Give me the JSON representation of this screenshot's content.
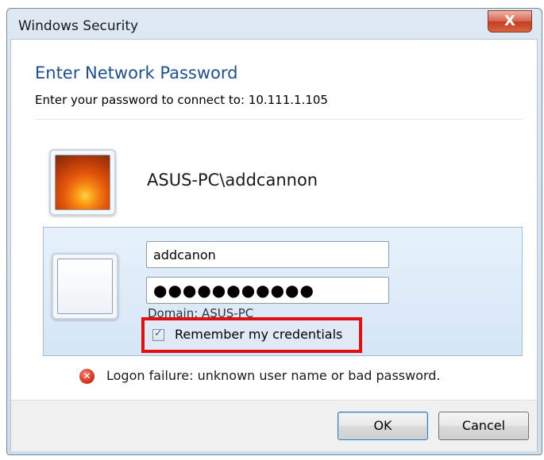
{
  "window": {
    "title": "Windows Security",
    "close_glyph": "X"
  },
  "dialog": {
    "heading": "Enter Network Password",
    "subheading": "Enter your password to connect to: 10.111.1.105"
  },
  "saved_credential": {
    "display_name": "ASUS-PC\\addcannon",
    "icon": "orange-flower-user-picture"
  },
  "credentials_form": {
    "icon": "blank-user-tile",
    "username_value": "addcanon",
    "password_value": "●●●●●●●●●●●",
    "domain_label": "Domain: ASUS-PC",
    "remember_label": "Remember my credentials",
    "remember_checked": true,
    "highlight_color": "#e01010"
  },
  "error": {
    "icon": "error-x-icon",
    "message": "Logon failure: unknown user name or bad password."
  },
  "buttons": {
    "ok_label": "OK",
    "cancel_label": "Cancel"
  }
}
